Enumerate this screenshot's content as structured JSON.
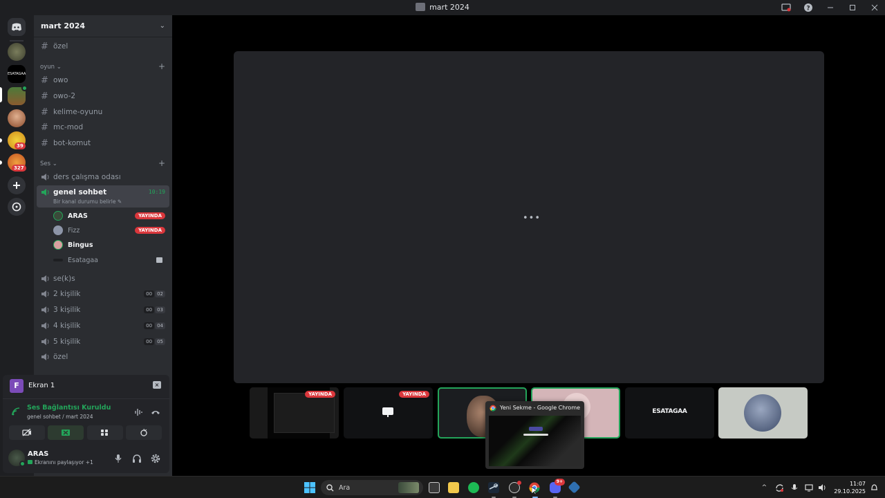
{
  "window": {
    "title": "mart 2024"
  },
  "rail": {
    "badges": [
      "39",
      "327"
    ]
  },
  "guild": {
    "name": "mart 2024",
    "top_channel": "özel",
    "categories": {
      "game": "oyun",
      "voice": "Ses"
    },
    "text_channels": [
      "owo",
      "owo-2",
      "kelime-oyunu",
      "mc-mod",
      "bot-komut"
    ],
    "voice_channels": {
      "study": "ders çalışma odası",
      "general": "genel sohbet",
      "general_timer": "10:19",
      "general_status": "Bir kanal durumu belirle",
      "seks": "se(k)s",
      "two": {
        "label": "2 kişilik",
        "count": "00",
        "limit": "02"
      },
      "three": {
        "label": "3 kişilik",
        "count": "00",
        "limit": "03"
      },
      "four": {
        "label": "4 kişilik",
        "count": "00",
        "limit": "04"
      },
      "five": {
        "label": "5 kişilik",
        "count": "00",
        "limit": "05"
      },
      "private": "özel"
    },
    "voice_users": [
      {
        "name": "ARAS",
        "live": "YAYINDA"
      },
      {
        "name": "Fizz",
        "live": "YAYINDA"
      },
      {
        "name": "Bingus"
      },
      {
        "name": "Esatagaa"
      }
    ]
  },
  "panel": {
    "screen_label": "Ekran 1",
    "screen_letter": "F",
    "voice_status": "Ses Bağlantısı Kuruldu",
    "voice_location": "genel sohbet / mart 2024",
    "user_name": "ARAS",
    "user_status": "Ekranını paylaşıyor +1"
  },
  "stage": {
    "loading": "•••",
    "tiles": [
      {
        "badge": "YAYINDA"
      },
      {
        "badge": "YAYINDA"
      },
      {},
      {},
      {
        "label": "ESATAGAA"
      },
      {}
    ]
  },
  "chrome_preview": {
    "title": "Yeni Sekme - Google Chrome"
  },
  "taskbar": {
    "search_placeholder": "Ara",
    "discord_badge": "9+",
    "time": "11:07",
    "date": "29.10.2025"
  },
  "colors": {
    "accent_green": "#23a55a",
    "live_red": "#da373c",
    "blurple": "#5865f2"
  }
}
